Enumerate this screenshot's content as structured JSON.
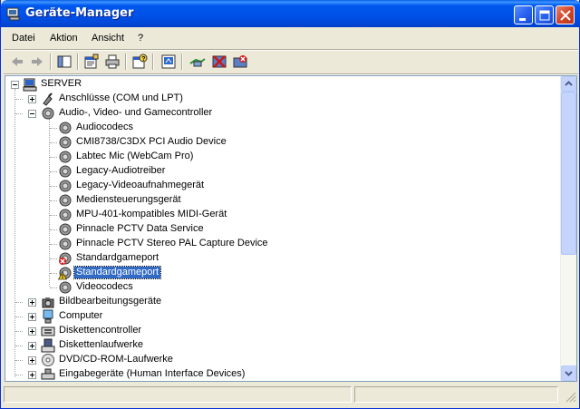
{
  "window": {
    "title": "Geräte-Manager",
    "colors": {
      "titlebar": "#0054E3",
      "selection": "#316AC5",
      "face": "#ECE9D8"
    }
  },
  "menu": [
    "Datei",
    "Aktion",
    "Ansicht",
    "?"
  ],
  "toolbar_icons": [
    "back-icon",
    "forward-icon",
    "show-hide-console-tree-icon",
    "properties-icon",
    "print-icon",
    "help-icon",
    "scan-hardware-icon",
    "update-driver-icon",
    "disable-device-icon",
    "uninstall-device-icon"
  ],
  "tree": {
    "root": "SERVER",
    "items": [
      {
        "label": "Anschlüsse (COM und LPT)",
        "icon": "port-icon",
        "expanded": false
      },
      {
        "label": "Audio-, Video- und Gamecontroller",
        "icon": "audio-icon",
        "expanded": true
      },
      {
        "label": "Bildbearbeitungsgeräte",
        "icon": "imaging-icon",
        "expanded": false
      },
      {
        "label": "Computer",
        "icon": "computer-icon",
        "expanded": false
      },
      {
        "label": "Diskettencontroller",
        "icon": "floppy-controller-icon",
        "expanded": false
      },
      {
        "label": "Diskettenlaufwerke",
        "icon": "floppy-drive-icon",
        "expanded": false
      },
      {
        "label": "DVD/CD-ROM-Laufwerke",
        "icon": "cdrom-icon",
        "expanded": false
      },
      {
        "label": "Eingabegeräte (Human Interface Devices)",
        "icon": "hid-icon",
        "expanded": false
      }
    ],
    "audio_children": [
      {
        "label": "Audiocodecs",
        "status": "ok"
      },
      {
        "label": "CMI8738/C3DX PCI Audio Device",
        "status": "ok"
      },
      {
        "label": "Labtec Mic (WebCam Pro)",
        "status": "ok"
      },
      {
        "label": "Legacy-Audiotreiber",
        "status": "ok"
      },
      {
        "label": "Legacy-Videoaufnahmegerät",
        "status": "ok"
      },
      {
        "label": "Mediensteuerungsgerät",
        "status": "ok"
      },
      {
        "label": "MPU-401-kompatibles MIDI-Gerät",
        "status": "ok"
      },
      {
        "label": "Pinnacle PCTV Data Service",
        "status": "ok"
      },
      {
        "label": "Pinnacle PCTV Stereo PAL Capture Device",
        "status": "ok"
      },
      {
        "label": "Standardgameport",
        "status": "disabled"
      },
      {
        "label": "Standardgameport",
        "status": "warning",
        "selected": true
      },
      {
        "label": "Videocodecs",
        "status": "ok"
      }
    ]
  },
  "statusbar": {
    "panes": [
      "",
      ""
    ]
  }
}
